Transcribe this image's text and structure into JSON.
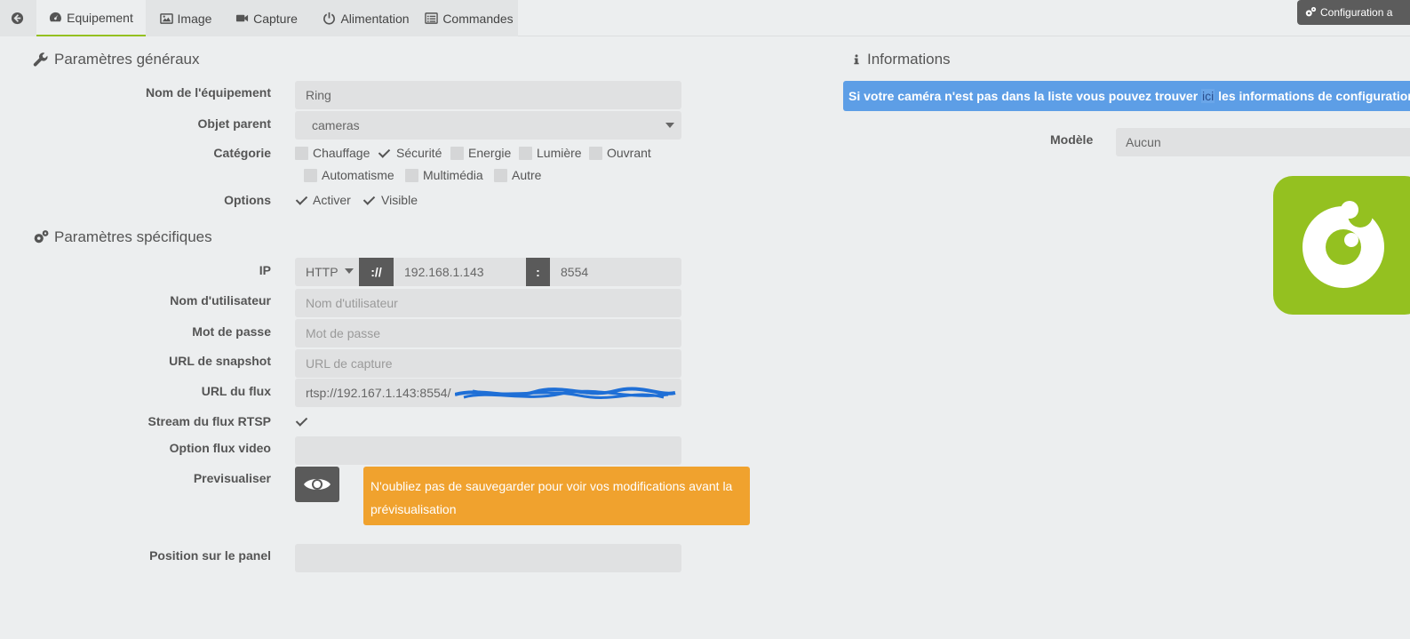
{
  "tabs": {
    "equipement": "Equipement",
    "image": "Image",
    "capture": "Capture",
    "alimentation": "Alimentation",
    "commandes": "Commandes"
  },
  "config_button": "Configuration a",
  "general": {
    "title": "Paramètres généraux",
    "name_label": "Nom de l'équipement",
    "name_value": "Ring",
    "parent_label": "Objet parent",
    "parent_value": "cameras",
    "category_label": "Catégorie",
    "categories": [
      {
        "label": "Chauffage",
        "checked": false
      },
      {
        "label": "Sécurité",
        "checked": true
      },
      {
        "label": "Energie",
        "checked": false
      },
      {
        "label": "Lumière",
        "checked": false
      },
      {
        "label": "Ouvrant",
        "checked": false
      },
      {
        "label": "Automatisme",
        "checked": false
      },
      {
        "label": "Multimédia",
        "checked": false
      },
      {
        "label": "Autre",
        "checked": false
      }
    ],
    "options_label": "Options",
    "options": [
      {
        "label": "Activer",
        "checked": true
      },
      {
        "label": "Visible",
        "checked": true
      }
    ]
  },
  "specific": {
    "title": "Paramètres spécifiques",
    "ip_label": "IP",
    "protocol": "HTTP",
    "sep_scheme": "://",
    "host": "192.168.1.143",
    "sep_port": ":",
    "port": "8554",
    "user_label": "Nom d'utilisateur",
    "user_placeholder": "Nom d'utilisateur",
    "pass_label": "Mot de passe",
    "pass_placeholder": "Mot de passe",
    "snapshot_label": "URL de snapshot",
    "snapshot_placeholder": "URL de capture",
    "stream_label": "URL du flux",
    "stream_value": "rtsp://192.167.1.143:8554/",
    "rtsp_label": "Stream du flux RTSP",
    "rtsp_checked": true,
    "video_opt_label": "Option flux video",
    "preview_label": "Previsualiser",
    "warning": "N'oubliez pas de sauvegarder pour voir vos modifications avant la prévisualisation",
    "position_label": "Position sur le panel"
  },
  "info": {
    "title": "Informations",
    "banner_before": "Si votre caméra n'est pas dans la liste vous pouvez trouver",
    "banner_link": "ici",
    "banner_after": "les informations de configuration pou",
    "model_label": "Modèle",
    "model_value": "Aucun"
  },
  "colors": {
    "accent": "#94c020",
    "warning": "#f0a22e",
    "info": "#5d9ee6"
  }
}
